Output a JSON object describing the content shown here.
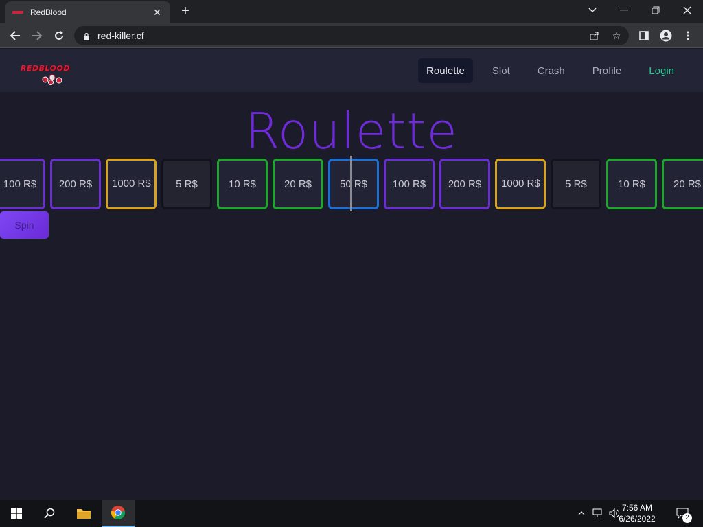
{
  "browser": {
    "tab_title": "RedBlood",
    "url": "red-killer.cf"
  },
  "site": {
    "logo_text": "REDBLOOD",
    "nav": [
      {
        "label": "Roulette",
        "active": true
      },
      {
        "label": "Slot"
      },
      {
        "label": "Crash"
      },
      {
        "label": "Profile"
      },
      {
        "label": "Login"
      }
    ],
    "title": "Roulette",
    "spin_label": "Spin",
    "reel": [
      {
        "label": "100 R$",
        "color": "purple"
      },
      {
        "label": "200 R$",
        "color": "purple"
      },
      {
        "label": "1000 R$",
        "color": "gold"
      },
      {
        "label": "5 R$",
        "color": "dark"
      },
      {
        "label": "10 R$",
        "color": "green"
      },
      {
        "label": "20 R$",
        "color": "green"
      },
      {
        "label": "50 R$",
        "color": "blue"
      },
      {
        "label": "100 R$",
        "color": "purple"
      },
      {
        "label": "200 R$",
        "color": "purple"
      },
      {
        "label": "1000 R$",
        "color": "gold"
      },
      {
        "label": "5 R$",
        "color": "dark"
      },
      {
        "label": "10 R$",
        "color": "green"
      },
      {
        "label": "20 R$",
        "color": "green"
      }
    ]
  },
  "taskbar": {
    "time": "7:56 AM",
    "date": "6/26/2022",
    "notification_count": "2"
  },
  "colors": {
    "accent_purple": "#6f2bd9",
    "login_green": "#2fc995",
    "background": "#1b1b29"
  }
}
